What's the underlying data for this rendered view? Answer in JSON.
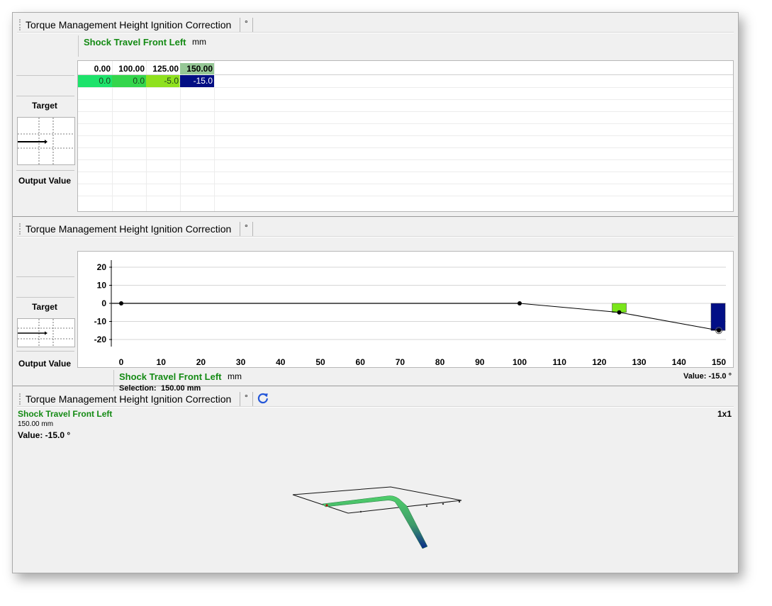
{
  "panel_title": "Torque Management Height Ignition Correction",
  "output_unit": "°",
  "axis": {
    "name": "Shock Travel Front Left",
    "unit": "mm"
  },
  "left_labels": {
    "target": "Target",
    "output": "Output Value"
  },
  "table": {
    "headers": [
      "0.00",
      "100.00",
      "125.00",
      "150.00"
    ],
    "values": [
      "0.0",
      "0.0",
      "-5.0",
      "-15.0"
    ],
    "cell_colors": [
      "#1de36b",
      "#34d64c",
      "#8fe11e",
      "#030e84"
    ],
    "header_selected_color": "#95c795",
    "selected_index": 3
  },
  "chart_data": {
    "type": "line",
    "x": [
      0,
      100,
      125,
      150
    ],
    "y": [
      0,
      0,
      -5,
      -15
    ],
    "xlim": [
      0,
      150
    ],
    "ylim": [
      -20,
      20
    ],
    "xticks": [
      "0",
      "10",
      "20",
      "30",
      "40",
      "50",
      "60",
      "70",
      "80",
      "90",
      "100",
      "110",
      "120",
      "130",
      "140",
      "150"
    ],
    "yticks": [
      "20",
      "10",
      "0",
      "-10",
      "-20"
    ],
    "bars": [
      {
        "x": 125,
        "value": -5,
        "color": "#7ae61a"
      },
      {
        "x": 150,
        "value": -15,
        "color": "#020f86"
      }
    ],
    "grid": true
  },
  "panel2": {
    "selection_label": "Selection:",
    "selection_value": "150.00 mm",
    "value_text": "Value: -15.0 °"
  },
  "panel3": {
    "axis_name": "Shock Travel Front Left",
    "position": "150.00 mm",
    "value_text": "Value: -15.0 °",
    "size_label": "1x1"
  },
  "icons": {
    "refresh": "refresh-icon",
    "target": "target-crosshair-icon"
  }
}
